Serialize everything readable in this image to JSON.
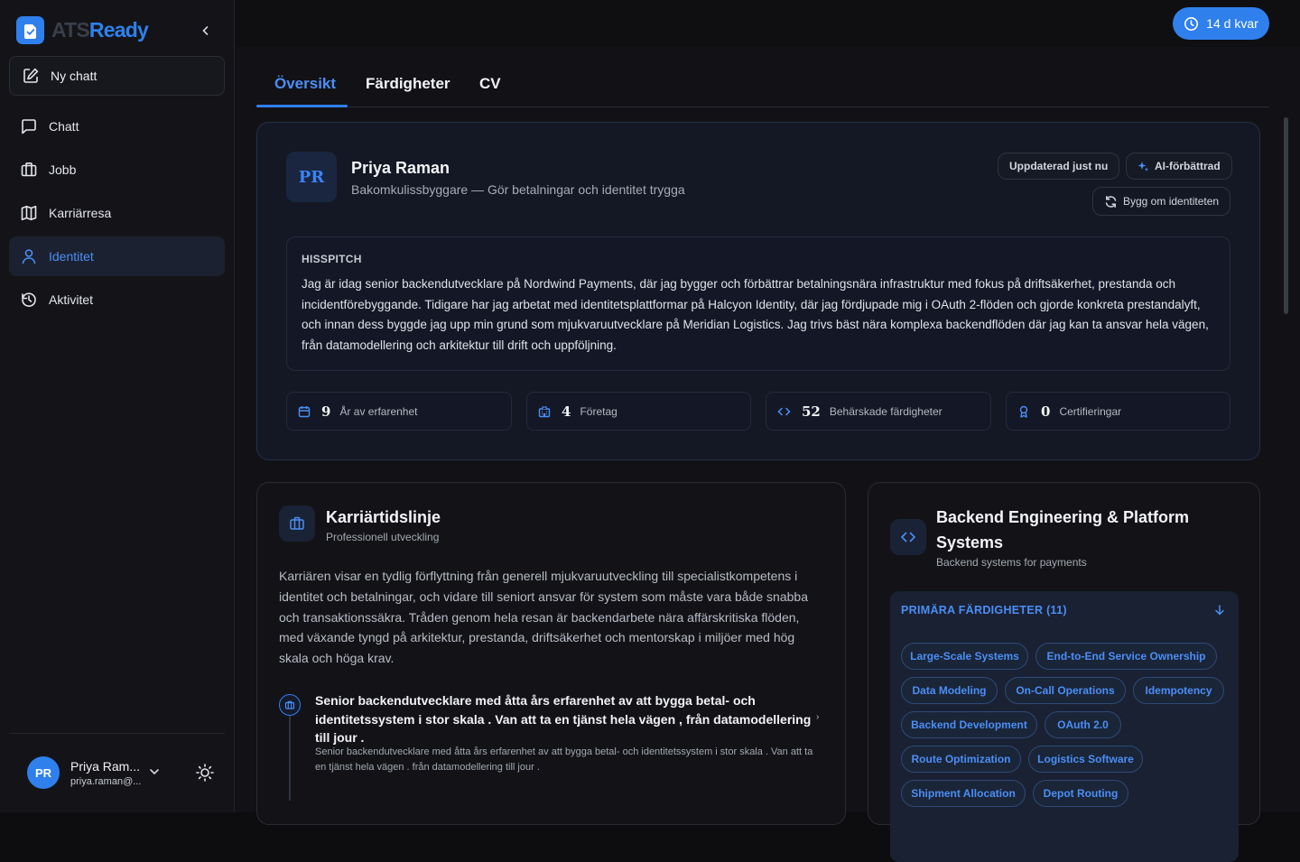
{
  "app": {
    "logo_part1": "ATS",
    "logo_part2": "Ready",
    "new_chat": "Ny chatt"
  },
  "sidebar": {
    "items": [
      {
        "label": "Chatt",
        "icon": "chat-icon"
      },
      {
        "label": "Jobb",
        "icon": "briefcase-icon"
      },
      {
        "label": "Karriärresa",
        "icon": "map-icon"
      },
      {
        "label": "Identitet",
        "icon": "user-icon",
        "active": true
      },
      {
        "label": "Aktivitet",
        "icon": "history-icon"
      }
    ],
    "user": {
      "initials": "PR",
      "name": "Priya Ram...",
      "email": "priya.raman@..."
    }
  },
  "topbar": {
    "trial": "14 d kvar"
  },
  "tabs": [
    {
      "label": "Översikt",
      "active": true
    },
    {
      "label": "Färdigheter"
    },
    {
      "label": "CV"
    }
  ],
  "profile": {
    "initials": "PR",
    "name": "Priya Raman",
    "title": "Bakomkulissbyggare — Gör betalningar och identitet trygga",
    "updated": "Uppdaterad just nu",
    "ai": "AI-förbättrad",
    "rebuild": "Bygg om identiteten",
    "pitch_heading": "HISSPITCH",
    "pitch": "Jag är idag senior backendutvecklare på Nordwind Payments, där jag bygger och förbättrar betalningsnära infrastruktur med fokus på driftsäkerhet, prestanda och incidentförebyggande. Tidigare har jag arbetat med identitetsplattformar på Halcyon Identity, där jag fördjupade mig i OAuth 2-flöden och gjorde konkreta prestandalyft, och innan dess byggde jag upp min grund som mjukvaruutvecklare på Meridian Logistics. Jag trivs bäst nära komplexa backendflöden där jag kan ta ansvar hela vägen, från datamodellering och arkitektur till drift och uppföljning.",
    "stats": [
      {
        "value": "9",
        "label": "År av erfarenhet",
        "icon": "calendar-icon"
      },
      {
        "value": "4",
        "label": "Företag",
        "icon": "building-icon"
      },
      {
        "value": "52",
        "label": "Behärskade färdigheter",
        "icon": "code-icon"
      },
      {
        "value": "0",
        "label": "Certifieringar",
        "icon": "award-icon"
      }
    ]
  },
  "timeline": {
    "title": "Karriärtidslinje",
    "subtitle": "Professionell utveckling",
    "text": "Karriären visar en tydlig förflyttning från generell mjukvaruutveckling till specialistkompetens i identitet och betalningar, och vidare till seniort ansvar för system som måste vara både snabba och transaktionssäkra. Tråden genom hela resan är backendarbete nära affärskritiska flöden, med växande tyngd på arkitektur, prestanda, driftsäkerhet och mentorskap i miljöer med hög skala och höga krav.",
    "entry_title": "Senior backendutvecklare med åtta års erfarenhet av att bygga betal- och identitetssystem i stor skala . Van att ta en tjänst hela vägen , från datamodellering till jour .",
    "entry_desc": "Senior backendutvecklare med åtta års erfarenhet av att bygga betal- och identitetssystem i stor skala . Van att ta en tjänst hela vägen . från datamodellering till jour ."
  },
  "skills_card": {
    "title": "Backend Engineering & Platform Systems",
    "subtitle": "Backend systems for payments",
    "primary_heading": "PRIMÄRA FÄRDIGHETER (11)",
    "chips": [
      "Large-Scale Systems",
      "End-to-End Service Ownership",
      "Data Modeling",
      "On-Call Operations",
      "Idempotency",
      "Backend Development",
      "OAuth 2.0",
      "Route Optimization",
      "Logistics Software",
      "Shipment Allocation",
      "Depot Routing"
    ]
  },
  "colors": {
    "accent": "#2f80ed",
    "background": "#121216",
    "sidebar": "#141418"
  }
}
